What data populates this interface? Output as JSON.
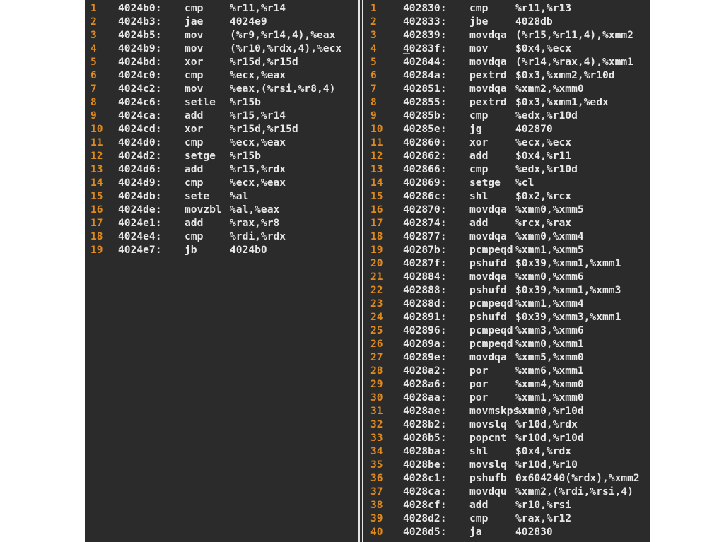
{
  "left": [
    {
      "ln": "1",
      "addr": "4024b0:",
      "mn": "cmp",
      "ops": "%r11,%r14"
    },
    {
      "ln": "2",
      "addr": "4024b3:",
      "mn": "jae",
      "ops": "4024e9"
    },
    {
      "ln": "3",
      "addr": "4024b5:",
      "mn": "mov",
      "ops": "(%r9,%r14,4),%eax"
    },
    {
      "ln": "4",
      "addr": "4024b9:",
      "mn": "mov",
      "ops": "(%r10,%rdx,4),%ecx"
    },
    {
      "ln": "5",
      "addr": "4024bd:",
      "mn": "xor",
      "ops": "%r15d,%r15d"
    },
    {
      "ln": "6",
      "addr": "4024c0:",
      "mn": "cmp",
      "ops": "%ecx,%eax"
    },
    {
      "ln": "7",
      "addr": "4024c2:",
      "mn": "mov",
      "ops": "%eax,(%rsi,%r8,4)"
    },
    {
      "ln": "8",
      "addr": "4024c6:",
      "mn": "setle",
      "ops": "%r15b"
    },
    {
      "ln": "9",
      "addr": "4024ca:",
      "mn": "add",
      "ops": "%r15,%r14"
    },
    {
      "ln": "10",
      "addr": "4024cd:",
      "mn": "xor",
      "ops": "%r15d,%r15d"
    },
    {
      "ln": "11",
      "addr": "4024d0:",
      "mn": "cmp",
      "ops": "%ecx,%eax"
    },
    {
      "ln": "12",
      "addr": "4024d2:",
      "mn": "setge",
      "ops": "%r15b"
    },
    {
      "ln": "13",
      "addr": "4024d6:",
      "mn": "add",
      "ops": "%r15,%rdx"
    },
    {
      "ln": "14",
      "addr": "4024d9:",
      "mn": "cmp",
      "ops": "%ecx,%eax"
    },
    {
      "ln": "15",
      "addr": "4024db:",
      "mn": "sete",
      "ops": "%al"
    },
    {
      "ln": "16",
      "addr": "4024de:",
      "mn": "movzbl",
      "ops": "%al,%eax"
    },
    {
      "ln": "17",
      "addr": "4024e1:",
      "mn": "add",
      "ops": "%rax,%r8"
    },
    {
      "ln": "18",
      "addr": "4024e4:",
      "mn": "cmp",
      "ops": "%rdi,%rdx"
    },
    {
      "ln": "19",
      "addr": "4024e7:",
      "mn": "jb",
      "ops": "4024b0"
    }
  ],
  "right": [
    {
      "ln": "1",
      "addr": "402830:",
      "mn": "cmp",
      "ops": "%r11,%r13"
    },
    {
      "ln": "2",
      "addr": "402833:",
      "mn": "jbe",
      "ops": "4028db"
    },
    {
      "ln": "3",
      "addr": "402839:",
      "mn": "movdqa",
      "ops": "(%r15,%r11,4),%xmm2"
    },
    {
      "ln": "4",
      "addr": "40283f:",
      "mn": "mov",
      "ops": "$0x4,%ecx"
    },
    {
      "ln": "5",
      "addr": "402844:",
      "mn": "movdqa",
      "ops": "(%r14,%rax,4),%xmm1"
    },
    {
      "ln": "6",
      "addr": "40284a:",
      "mn": "pextrd",
      "ops": "$0x3,%xmm2,%r10d"
    },
    {
      "ln": "7",
      "addr": "402851:",
      "mn": "movdqa",
      "ops": "%xmm2,%xmm0"
    },
    {
      "ln": "8",
      "addr": "402855:",
      "mn": "pextrd",
      "ops": "$0x3,%xmm1,%edx"
    },
    {
      "ln": "9",
      "addr": "40285b:",
      "mn": "cmp",
      "ops": "%edx,%r10d"
    },
    {
      "ln": "10",
      "addr": "40285e:",
      "mn": "jg",
      "ops": "402870"
    },
    {
      "ln": "11",
      "addr": "402860:",
      "mn": "xor",
      "ops": "%ecx,%ecx"
    },
    {
      "ln": "12",
      "addr": "402862:",
      "mn": "add",
      "ops": "$0x4,%r11"
    },
    {
      "ln": "13",
      "addr": "402866:",
      "mn": "cmp",
      "ops": "%edx,%r10d"
    },
    {
      "ln": "14",
      "addr": "402869:",
      "mn": "setge",
      "ops": "%cl"
    },
    {
      "ln": "15",
      "addr": "40286c:",
      "mn": "shl",
      "ops": "$0x2,%rcx"
    },
    {
      "ln": "16",
      "addr": "402870:",
      "mn": "movdqa",
      "ops": "%xmm0,%xmm5"
    },
    {
      "ln": "17",
      "addr": "402874:",
      "mn": "add",
      "ops": "%rcx,%rax"
    },
    {
      "ln": "18",
      "addr": "402877:",
      "mn": "movdqa",
      "ops": "%xmm0,%xmm4"
    },
    {
      "ln": "19",
      "addr": "40287b:",
      "mn": "pcmpeqd",
      "ops": "%xmm1,%xmm5"
    },
    {
      "ln": "20",
      "addr": "40287f:",
      "mn": "pshufd",
      "ops": "$0x39,%xmm1,%xmm1"
    },
    {
      "ln": "21",
      "addr": "402884:",
      "mn": "movdqa",
      "ops": "%xmm0,%xmm6"
    },
    {
      "ln": "22",
      "addr": "402888:",
      "mn": "pshufd",
      "ops": "$0x39,%xmm1,%xmm3"
    },
    {
      "ln": "23",
      "addr": "40288d:",
      "mn": "pcmpeqd",
      "ops": "%xmm1,%xmm4"
    },
    {
      "ln": "24",
      "addr": "402891:",
      "mn": "pshufd",
      "ops": "$0x39,%xmm3,%xmm1"
    },
    {
      "ln": "25",
      "addr": "402896:",
      "mn": "pcmpeqd",
      "ops": "%xmm3,%xmm6"
    },
    {
      "ln": "26",
      "addr": "40289a:",
      "mn": "pcmpeqd",
      "ops": "%xmm0,%xmm1"
    },
    {
      "ln": "27",
      "addr": "40289e:",
      "mn": "movdqa",
      "ops": "%xmm5,%xmm0"
    },
    {
      "ln": "28",
      "addr": "4028a2:",
      "mn": "por",
      "ops": "%xmm6,%xmm1"
    },
    {
      "ln": "29",
      "addr": "4028a6:",
      "mn": "por",
      "ops": "%xmm4,%xmm0"
    },
    {
      "ln": "30",
      "addr": "4028aa:",
      "mn": "por",
      "ops": "%xmm1,%xmm0"
    },
    {
      "ln": "31",
      "addr": "4028ae:",
      "mn": "movmskps",
      "ops": "%xmm0,%r10d"
    },
    {
      "ln": "32",
      "addr": "4028b2:",
      "mn": "movslq",
      "ops": "%r10d,%rdx"
    },
    {
      "ln": "33",
      "addr": "4028b5:",
      "mn": "popcnt",
      "ops": "%r10d,%r10d"
    },
    {
      "ln": "34",
      "addr": "4028ba:",
      "mn": "shl",
      "ops": "$0x4,%rdx"
    },
    {
      "ln": "35",
      "addr": "4028be:",
      "mn": "movslq",
      "ops": "%r10d,%r10"
    },
    {
      "ln": "36",
      "addr": "4028c1:",
      "mn": "pshufb",
      "ops": "0x604240(%rdx),%xmm2"
    },
    {
      "ln": "37",
      "addr": "4028ca:",
      "mn": "movdqu",
      "ops": "%xmm2,(%rdi,%rsi,4)"
    },
    {
      "ln": "38",
      "addr": "4028cf:",
      "mn": "add",
      "ops": "%r10,%rsi"
    },
    {
      "ln": "39",
      "addr": "4028d2:",
      "mn": "cmp",
      "ops": "%rax,%r12"
    },
    {
      "ln": "40",
      "addr": "4028d5:",
      "mn": "ja",
      "ops": "402830"
    }
  ],
  "colors": {
    "background": "#2b2b2b",
    "line_number": "#e08a1e",
    "text": "#e8e8e8",
    "cursor": "#3ad1c9"
  }
}
